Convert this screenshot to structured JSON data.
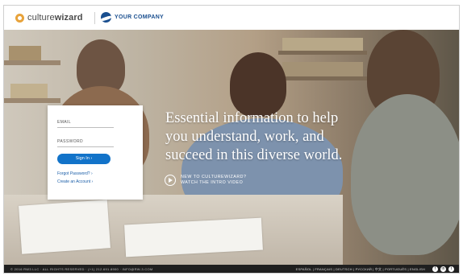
{
  "header": {
    "logo_prefix": "culture",
    "logo_suffix": "wizard",
    "company_name": "YOUR COMPANY"
  },
  "login": {
    "email_label": "EMAIL",
    "password_label": "PASSWORD",
    "signin_label": "Sign In ›",
    "forgot_label": "Forgot Password? ›",
    "create_label": "Create an Account ›"
  },
  "hero": {
    "headline_line1": "Essential information to help",
    "headline_line2": "you understand, work, and",
    "headline_line3": "succeed in this diverse world.",
    "video_line1": "NEW TO CULTUREWIZARD?",
    "video_line2": "WATCH THE INTRO VIDEO"
  },
  "footer": {
    "copyright": "© 2016 RW3 LLC · ALL RIGHTS RESERVED · (+1) 212.691.8900 · INFO@RW-3.COM",
    "languages": "ESPAÑOL | FRANÇAIS | DEUTSCH | РУССКИЙ | 中文 | PORTUGUÊS | ENGLISH",
    "social": [
      "f",
      "in",
      "t"
    ]
  },
  "colors": {
    "accent": "#1273c9",
    "brand_orange": "#e8a33b",
    "company_blue": "#1a4f8f"
  }
}
